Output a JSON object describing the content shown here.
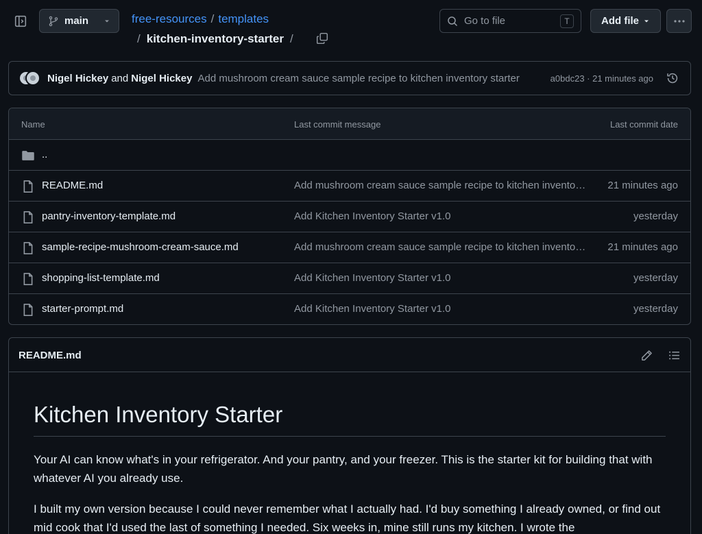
{
  "header": {
    "branch": "main",
    "breadcrumb": {
      "root": "free-resources",
      "folder": "templates",
      "current": "kitchen-inventory-starter"
    },
    "search": {
      "placeholder": "Go to file",
      "shortcut": "T"
    },
    "add_file_label": "Add file"
  },
  "commit": {
    "author1": "Nigel Hickey",
    "conjunction": "and",
    "author2": "Nigel Hickey",
    "message": "Add mushroom cream sauce sample recipe to kitchen inventory starter",
    "meta": "a0bdc23 · 21 minutes ago"
  },
  "table": {
    "columns": {
      "name": "Name",
      "message": "Last commit message",
      "date": "Last commit date"
    },
    "parent": "..",
    "rows": [
      {
        "name": "README.md",
        "message": "Add mushroom cream sauce sample recipe to kitchen inventory starter",
        "date": "21 minutes ago"
      },
      {
        "name": "pantry-inventory-template.md",
        "message": "Add Kitchen Inventory Starter v1.0",
        "date": "yesterday"
      },
      {
        "name": "sample-recipe-mushroom-cream-sauce.md",
        "message": "Add mushroom cream sauce sample recipe to kitchen inventory starter",
        "date": "21 minutes ago"
      },
      {
        "name": "shopping-list-template.md",
        "message": "Add Kitchen Inventory Starter v1.0",
        "date": "yesterday"
      },
      {
        "name": "starter-prompt.md",
        "message": "Add Kitchen Inventory Starter v1.0",
        "date": "yesterday"
      }
    ]
  },
  "readme": {
    "filename": "README.md",
    "heading": "Kitchen Inventory Starter",
    "paragraphs": [
      "Your AI can know what's in your refrigerator. And your pantry, and your freezer. This is the starter kit for building that with whatever AI you already use.",
      "I built my own version because I could never remember what I actually had. I'd buy something I already owned, or find out mid cook that I'd used the last of something I needed. Six weeks in, mine still runs my kitchen. I wrote the"
    ]
  },
  "icons": {
    "sidebar_toggle": "sidebar-toggle-icon",
    "branch": "git-branch-icon",
    "copy": "copy-icon",
    "search": "search-icon",
    "history": "history-icon",
    "folder": "folder-icon",
    "file": "file-icon",
    "edit": "pencil-icon",
    "outline": "list-icon"
  },
  "colors": {
    "background": "#0d1117",
    "border": "#3d444d",
    "link": "#4493f8",
    "muted": "#9198a1",
    "text": "#e6edf3"
  }
}
